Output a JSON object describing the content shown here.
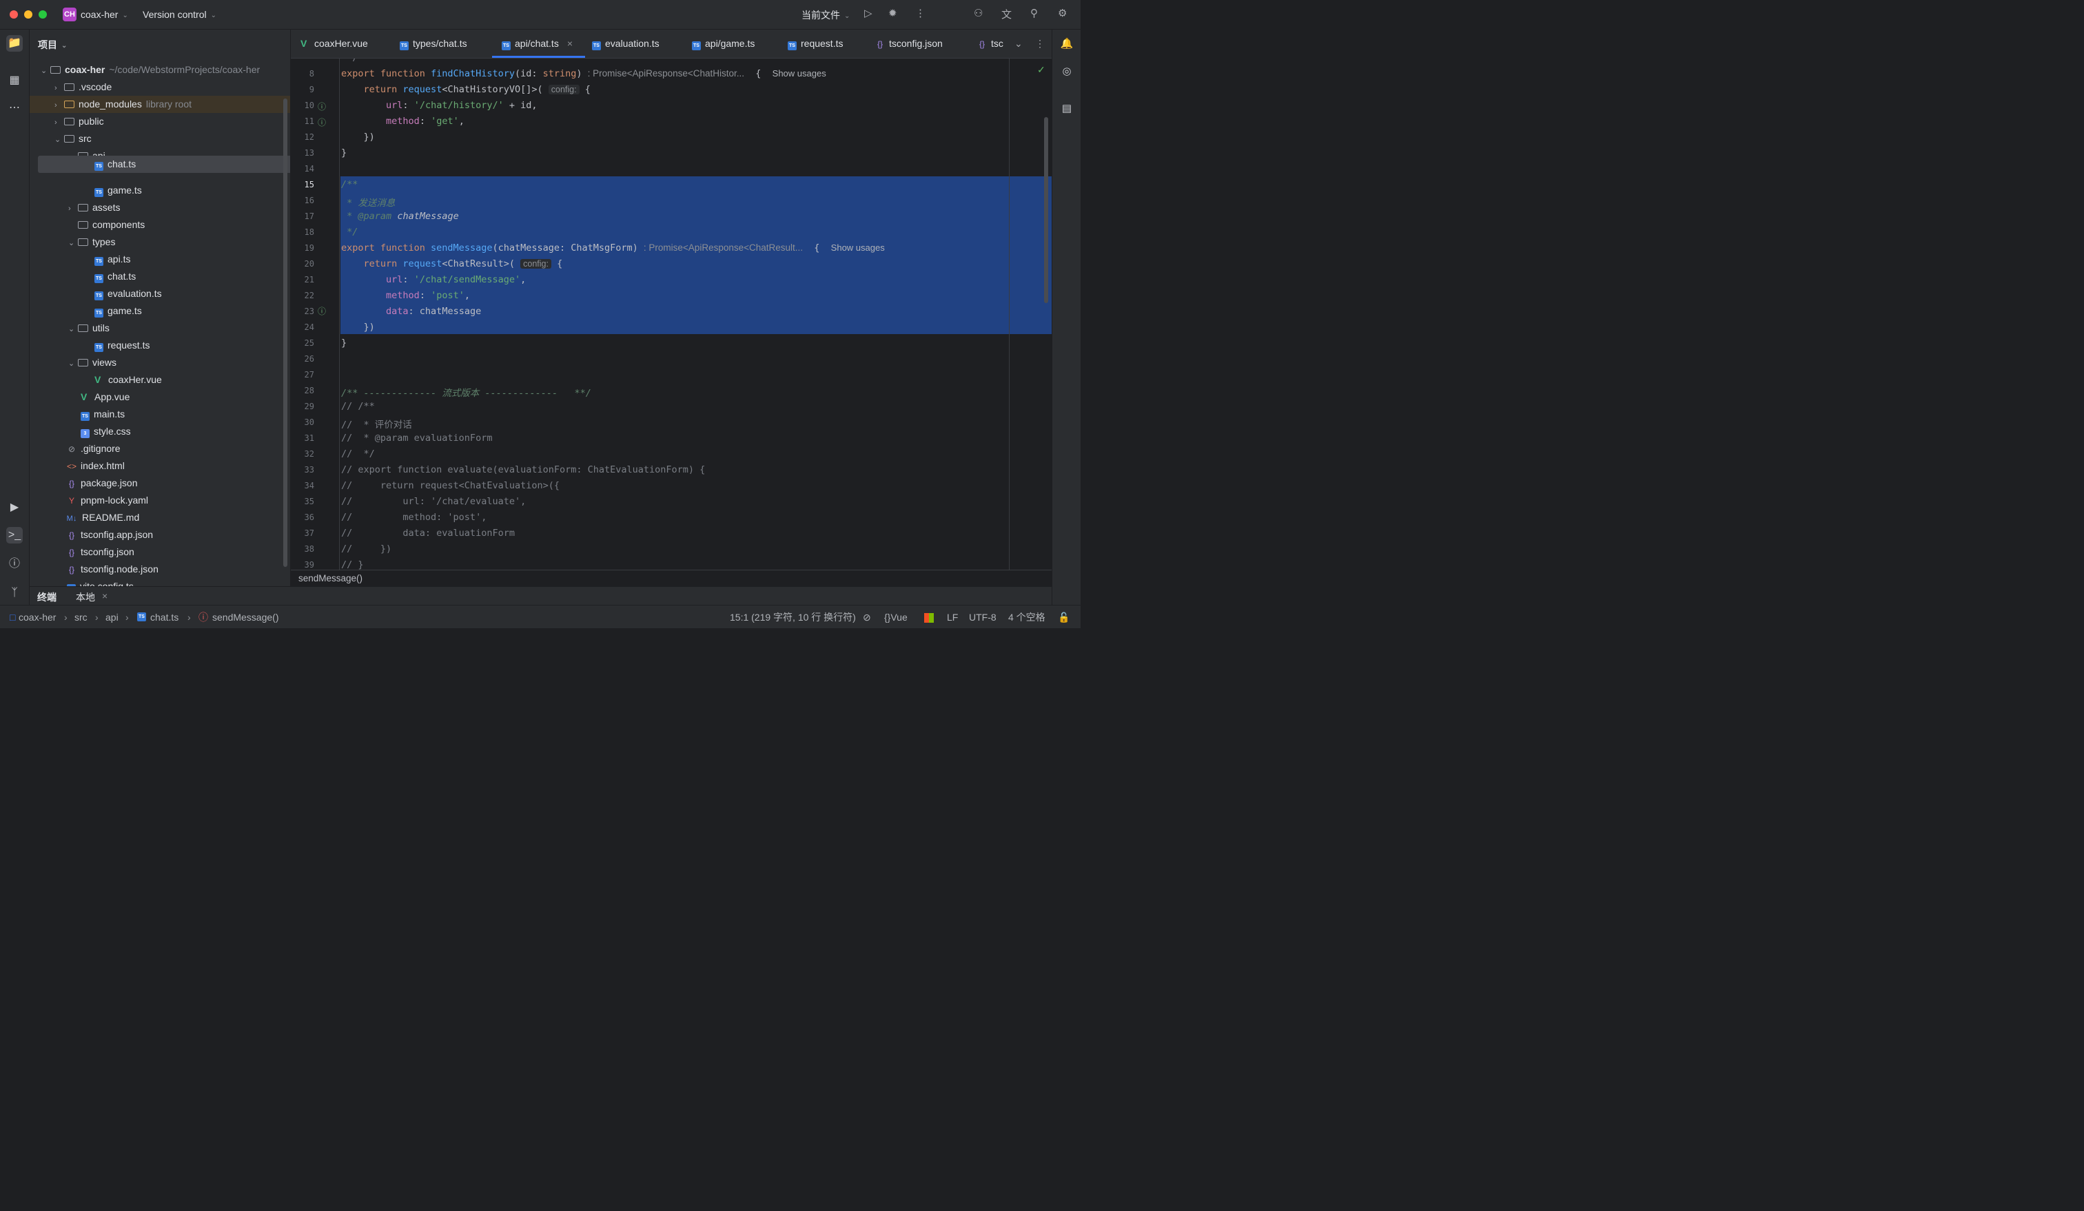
{
  "titlebar": {
    "project_badge": "CH",
    "project_name": "coax-her",
    "vcs_label": "Version control",
    "current_file": "当前文件"
  },
  "project_panel": {
    "title": "项目",
    "root_name": "coax-her",
    "root_path": "~/code/WebstormProjects/coax-her",
    "items": [
      {
        "label": "coax-her",
        "extra": "~/code/WebstormProjects/coax-her"
      },
      {
        "label": ".vscode",
        "extra": ""
      },
      {
        "label": "node_modules",
        "extra": "library root"
      },
      {
        "label": "public",
        "extra": ""
      },
      {
        "label": "src",
        "extra": ""
      },
      {
        "label": "api",
        "extra": ""
      },
      {
        "label": "chat.ts",
        "extra": ""
      },
      {
        "label": "game.ts",
        "extra": ""
      },
      {
        "label": "assets",
        "extra": ""
      },
      {
        "label": "components",
        "extra": ""
      },
      {
        "label": "types",
        "extra": ""
      },
      {
        "label": "api.ts",
        "extra": ""
      },
      {
        "label": "chat.ts",
        "extra": ""
      },
      {
        "label": "evaluation.ts",
        "extra": ""
      },
      {
        "label": "game.ts",
        "extra": ""
      },
      {
        "label": "utils",
        "extra": ""
      },
      {
        "label": "request.ts",
        "extra": ""
      },
      {
        "label": "views",
        "extra": ""
      },
      {
        "label": "coaxHer.vue",
        "extra": ""
      },
      {
        "label": "App.vue",
        "extra": ""
      },
      {
        "label": "main.ts",
        "extra": ""
      },
      {
        "label": "style.css",
        "extra": ""
      },
      {
        "label": ".gitignore",
        "extra": ""
      },
      {
        "label": "index.html",
        "extra": ""
      },
      {
        "label": "package.json",
        "extra": ""
      },
      {
        "label": "pnpm-lock.yaml",
        "extra": ""
      },
      {
        "label": "README.md",
        "extra": ""
      },
      {
        "label": "tsconfig.app.json",
        "extra": ""
      },
      {
        "label": "tsconfig.json",
        "extra": ""
      },
      {
        "label": "tsconfig.node.json",
        "extra": ""
      },
      {
        "label": "vite.config.ts",
        "extra": ""
      }
    ]
  },
  "tabs": [
    {
      "label": "coaxHer.vue"
    },
    {
      "label": "types/chat.ts"
    },
    {
      "label": "api/chat.ts",
      "active": true
    },
    {
      "label": "evaluation.ts"
    },
    {
      "label": "api/game.ts"
    },
    {
      "label": "request.ts"
    },
    {
      "label": "tsconfig.json"
    },
    {
      "label": "tsc"
    }
  ],
  "editor": {
    "line_numbers": [
      "8",
      "9",
      "10",
      "11",
      "12",
      "13",
      "14",
      "15",
      "16",
      "17",
      "18",
      "19",
      "20",
      "21",
      "22",
      "23",
      "24",
      "25",
      "26",
      "27",
      "28",
      "29",
      "30",
      "31",
      "32",
      "33",
      "34",
      "35",
      "36",
      "37",
      "38",
      "39"
    ],
    "inlay_return_1": ": Promise<ApiResponse<ChatHistor...",
    "inlay_return_2": ": Promise<ApiResponse<ChatResult...",
    "show_usages": "Show usages",
    "config_hint": "config:",
    "doc_summary": "发送消息",
    "doc_param_tag": "@param",
    "doc_param_name": "chatMessage",
    "stream_comment": "/** ------------- 流式版本 -------------   **/",
    "comment_lines": [
      "// /**",
      "//  * 评价对话",
      "//  * @param evaluationForm",
      "//  */",
      "// export function evaluate(evaluationForm: ChatEvaluationForm) {",
      "//     return request<ChatEvaluation>({",
      "//         url: '/chat/evaluate',",
      "//         method: 'post',",
      "//         data: evaluationForm",
      "//     })",
      "// }"
    ],
    "breadcrumb_fn": "sendMessage()"
  },
  "terminal": {
    "tab_label": "终端",
    "session_label": "本地"
  },
  "statusbar": {
    "path": [
      "coax-her",
      "src",
      "api",
      "chat.ts",
      "sendMessage()"
    ],
    "position": "15:1 (219 字符, 10 行 换行符)",
    "language": "Vue",
    "line_sep": "LF",
    "encoding": "UTF-8",
    "indent": "4 个空格"
  }
}
